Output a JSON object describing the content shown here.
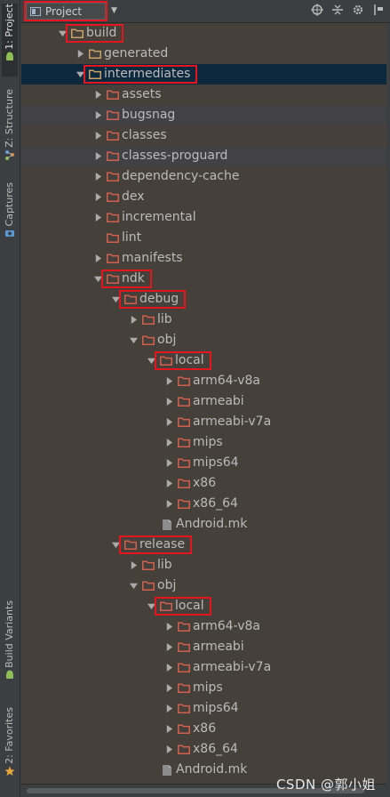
{
  "side_tabs": {
    "project": "1: Project",
    "structure": "Z: Structure",
    "captures": "Captures",
    "build_variants": "Build Variants",
    "favorites": "2: Favorites"
  },
  "header": {
    "view_selector": "Project",
    "icons": [
      "target-icon",
      "collapse-icon",
      "gear-icon",
      "pin-icon"
    ]
  },
  "tree": [
    {
      "label": "build",
      "depth": 0,
      "expanded": true,
      "kind": "folder",
      "highlight": true
    },
    {
      "label": "generated",
      "depth": 1,
      "expanded": false,
      "kind": "folder"
    },
    {
      "label": "intermediates",
      "depth": 1,
      "expanded": true,
      "kind": "folder",
      "highlight": true,
      "selected": true
    },
    {
      "label": "assets",
      "depth": 2,
      "expanded": false,
      "kind": "folder"
    },
    {
      "label": "bugsnag",
      "depth": 2,
      "expanded": false,
      "kind": "folder"
    },
    {
      "label": "classes",
      "depth": 2,
      "expanded": false,
      "kind": "folder"
    },
    {
      "label": "classes-proguard",
      "depth": 2,
      "expanded": false,
      "kind": "folder"
    },
    {
      "label": "dependency-cache",
      "depth": 2,
      "expanded": false,
      "kind": "folder"
    },
    {
      "label": "dex",
      "depth": 2,
      "expanded": false,
      "kind": "folder"
    },
    {
      "label": "incremental",
      "depth": 2,
      "expanded": false,
      "kind": "folder"
    },
    {
      "label": "lint",
      "depth": 2,
      "expanded": null,
      "kind": "folder"
    },
    {
      "label": "manifests",
      "depth": 2,
      "expanded": false,
      "kind": "folder"
    },
    {
      "label": "ndk",
      "depth": 2,
      "expanded": true,
      "kind": "folder",
      "highlight": true
    },
    {
      "label": "debug",
      "depth": 3,
      "expanded": true,
      "kind": "folder",
      "highlight": true
    },
    {
      "label": "lib",
      "depth": 4,
      "expanded": false,
      "kind": "folder"
    },
    {
      "label": "obj",
      "depth": 4,
      "expanded": true,
      "kind": "folder"
    },
    {
      "label": "local",
      "depth": 5,
      "expanded": true,
      "kind": "folder",
      "highlight": true
    },
    {
      "label": "arm64-v8a",
      "depth": 6,
      "expanded": false,
      "kind": "folder"
    },
    {
      "label": "armeabi",
      "depth": 6,
      "expanded": false,
      "kind": "folder"
    },
    {
      "label": "armeabi-v7a",
      "depth": 6,
      "expanded": false,
      "kind": "folder"
    },
    {
      "label": "mips",
      "depth": 6,
      "expanded": false,
      "kind": "folder"
    },
    {
      "label": "mips64",
      "depth": 6,
      "expanded": false,
      "kind": "folder"
    },
    {
      "label": "x86",
      "depth": 6,
      "expanded": false,
      "kind": "folder"
    },
    {
      "label": "x86_64",
      "depth": 6,
      "expanded": false,
      "kind": "folder"
    },
    {
      "label": "Android.mk",
      "depth": 5,
      "expanded": null,
      "kind": "file"
    },
    {
      "label": "release",
      "depth": 3,
      "expanded": true,
      "kind": "folder",
      "highlight": true
    },
    {
      "label": "lib",
      "depth": 4,
      "expanded": false,
      "kind": "folder"
    },
    {
      "label": "obj",
      "depth": 4,
      "expanded": true,
      "kind": "folder"
    },
    {
      "label": "local",
      "depth": 5,
      "expanded": true,
      "kind": "folder",
      "highlight": true
    },
    {
      "label": "arm64-v8a",
      "depth": 6,
      "expanded": false,
      "kind": "folder"
    },
    {
      "label": "armeabi",
      "depth": 6,
      "expanded": false,
      "kind": "folder"
    },
    {
      "label": "armeabi-v7a",
      "depth": 6,
      "expanded": false,
      "kind": "folder"
    },
    {
      "label": "mips",
      "depth": 6,
      "expanded": false,
      "kind": "folder"
    },
    {
      "label": "mips64",
      "depth": 6,
      "expanded": false,
      "kind": "folder"
    },
    {
      "label": "x86",
      "depth": 6,
      "expanded": false,
      "kind": "folder"
    },
    {
      "label": "x86_64",
      "depth": 6,
      "expanded": false,
      "kind": "folder"
    },
    {
      "label": "Android.mk",
      "depth": 5,
      "expanded": null,
      "kind": "file"
    }
  ],
  "colors": {
    "highlight_box": "#e3161f",
    "folder_normal": "#c9a26b",
    "folder_excluded": "#d0604f",
    "selection": "#0d293e"
  },
  "watermark": "CSDN @郭小姐"
}
